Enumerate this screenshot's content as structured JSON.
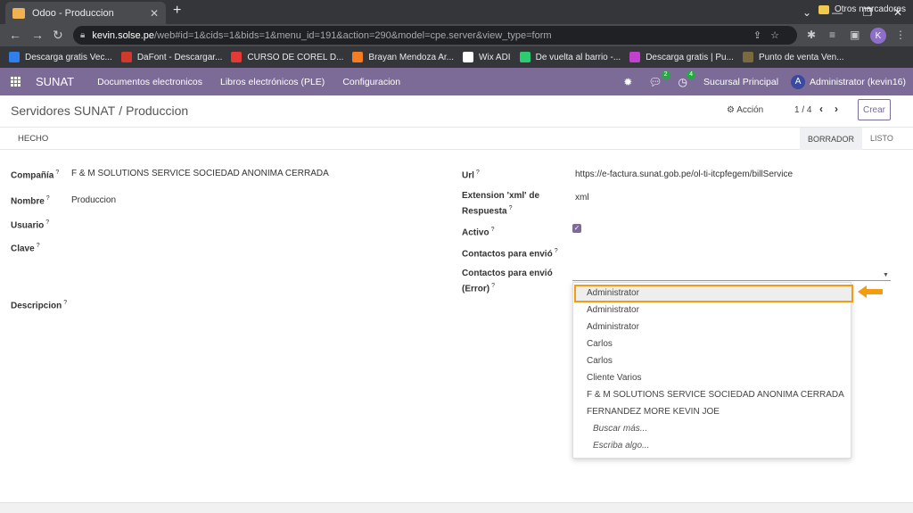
{
  "browser": {
    "tab_title": "Odoo - Produccion",
    "url_domain": "kevin.solse.pe",
    "url_rest": "/web#id=1&cids=1&bids=1&menu_id=191&action=290&model=cpe.server&view_type=form",
    "profile_initial": "K",
    "bookmarks": [
      {
        "label": "Descarga gratis Vec...",
        "color": "#2f80ed"
      },
      {
        "label": "DaFont - Descargar...",
        "color": "#d0392b"
      },
      {
        "label": "CURSO DE COREL D...",
        "color": "#e53935"
      },
      {
        "label": "Brayan Mendoza Ar...",
        "color": "#f57c20"
      },
      {
        "label": "Wix ADI",
        "color": "#ffffff"
      },
      {
        "label": "De vuelta al barrio -...",
        "color": "#2ecc71"
      },
      {
        "label": "Descarga gratis | Pu...",
        "color": "#c040d0"
      },
      {
        "label": "Punto de venta Ven...",
        "color": "#7a6a40"
      }
    ],
    "other_bookmarks": "Otros marcadores"
  },
  "navbar": {
    "brand": "SUNAT",
    "menus": [
      "Documentos electronicos",
      "Libros electrónicos (PLE)",
      "Configuracion"
    ],
    "messages_badge": "2",
    "activities_badge": "4",
    "branch": "Sucursal Principal",
    "user_initial": "A",
    "user": "Administrator (kevin16)"
  },
  "control": {
    "breadcrumb_parent": "Servidores SUNAT",
    "breadcrumb_sep": "/",
    "breadcrumb_current": "Produccion",
    "action_label": "Acción",
    "pager": "1 / 4",
    "create_label": "Crear"
  },
  "status": {
    "done_button": "HECHO",
    "stage_draft": "BORRADOR",
    "stage_list": "LISTO"
  },
  "form": {
    "company_label": "Compañía",
    "company_value": "F & M SOLUTIONS SERVICE SOCIEDAD ANONIMA CERRADA",
    "name_label": "Nombre",
    "name_value": "Produccion",
    "user_label": "Usuario",
    "key_label": "Clave",
    "description_label": "Descripcion",
    "url_label": "Url",
    "url_value": "https://e-factura.sunat.gob.pe/ol-ti-itcpfegem/billService",
    "ext_label_1": "Extension 'xml' de",
    "ext_label_2": "Respuesta",
    "ext_value": "xml",
    "active_label": "Activo",
    "active_checked": true,
    "contacts_label": "Contactos para envió",
    "contacts_err_label_1": "Contactos para envió",
    "contacts_err_label_2": "(Error)",
    "help_mark": "?"
  },
  "dropdown": {
    "options": [
      "Administrator",
      "Administrator",
      "Administrator",
      "Carlos",
      "Carlos",
      "Cliente Varios",
      "F & M SOLUTIONS SERVICE SOCIEDAD ANONIMA CERRADA",
      "FERNANDEZ MORE KEVIN JOE"
    ],
    "search_more": "Buscar más...",
    "type_something": "Escriba algo...",
    "highlight_color": "#f39c12"
  },
  "icons": [
    "lock-icon",
    "apps-grid-icon",
    "bug-icon",
    "chat-icon",
    "activity-icon",
    "gear-icon",
    "chevron-left-icon",
    "chevron-right-icon",
    "arrow-left-icon"
  ]
}
